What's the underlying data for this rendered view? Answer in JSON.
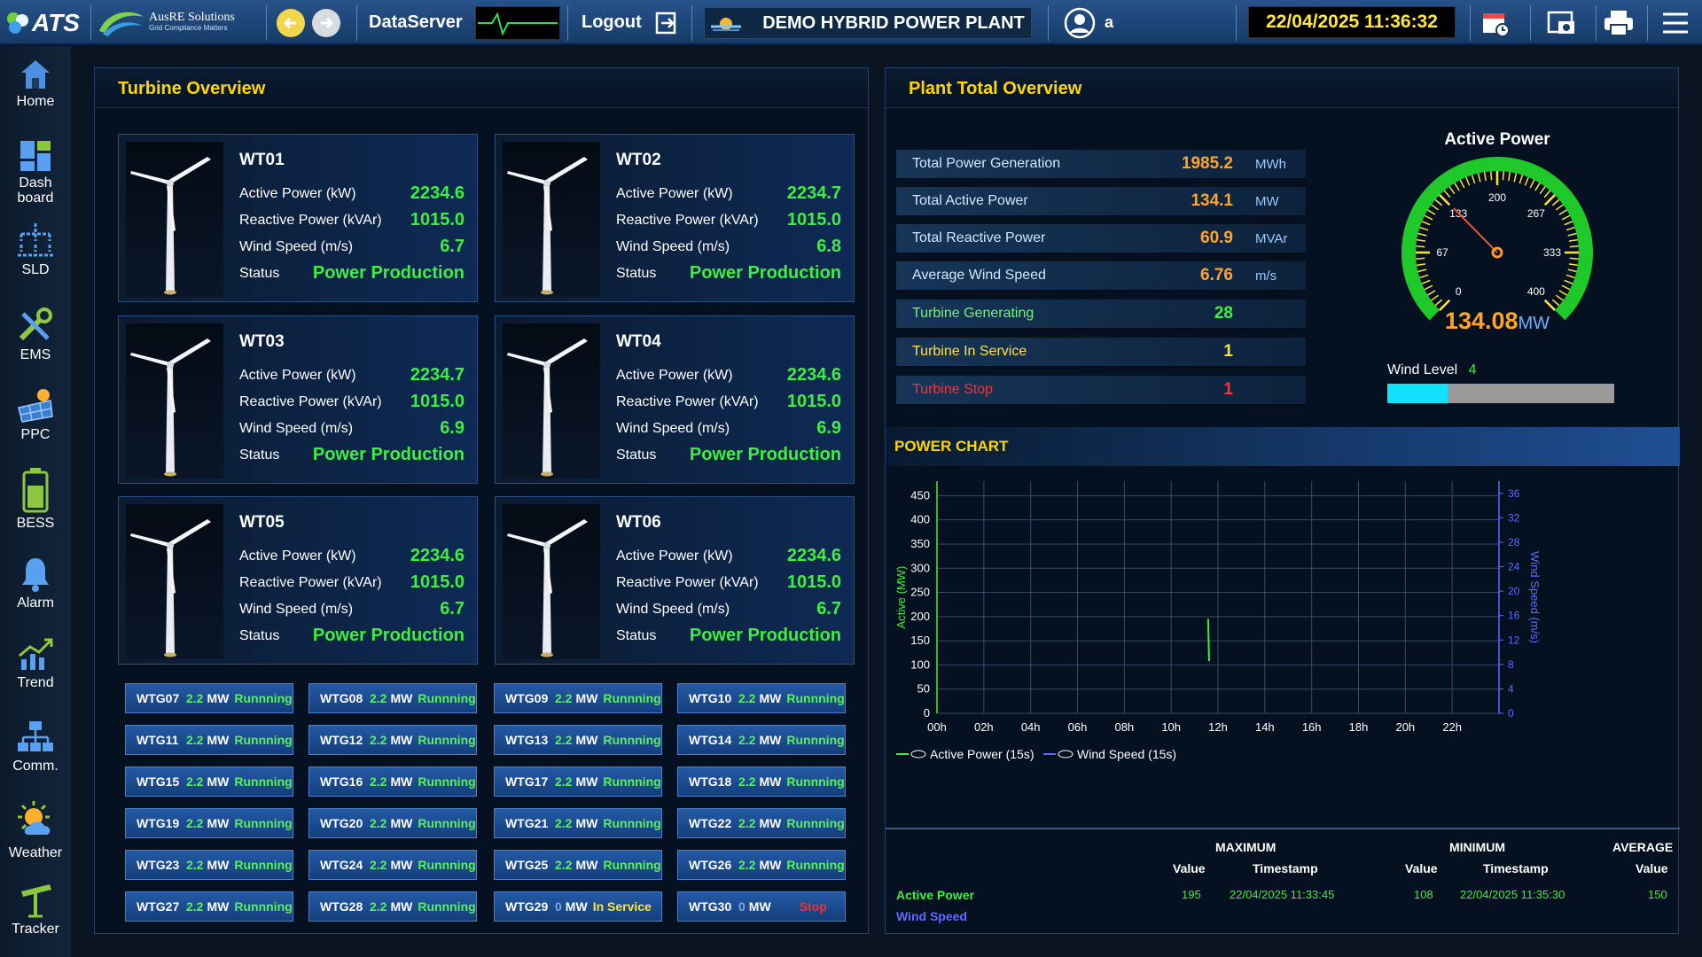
{
  "header": {
    "brand": "ATS",
    "company": "AusRE Solutions",
    "tagline": "Grid Compliance Matters",
    "server": "DataServer",
    "logout": "Logout",
    "plant": "DEMO HYBRID POWER PLANT",
    "user": "a",
    "datetime": "22/04/2025 11:36:32"
  },
  "nav": [
    {
      "label": "Home",
      "icon": "home-icon"
    },
    {
      "label": "Dash board",
      "icon": "dashboard-icon"
    },
    {
      "label": "SLD",
      "icon": "sld-icon"
    },
    {
      "label": "EMS",
      "icon": "tools-icon"
    },
    {
      "label": "PPC",
      "icon": "solar-panel-icon"
    },
    {
      "label": "BESS",
      "icon": "battery-icon"
    },
    {
      "label": "Alarm",
      "icon": "bell-icon"
    },
    {
      "label": "Trend",
      "icon": "trend-icon"
    },
    {
      "label": "Comm.",
      "icon": "network-icon"
    },
    {
      "label": "Weather",
      "icon": "weather-icon"
    },
    {
      "label": "Tracker",
      "icon": "tracker-icon"
    }
  ],
  "turbine_overview": {
    "title": "Turbine Overview",
    "labels": {
      "active": "Active Power (kW)",
      "reactive": "Reactive Power (kVAr)",
      "wind": "Wind Speed (m/s)",
      "status": "Status"
    },
    "turbines": [
      {
        "name": "WT01",
        "active": "2234.6",
        "reactive": "1015.0",
        "wind": "6.7",
        "status": "Power Production"
      },
      {
        "name": "WT02",
        "active": "2234.7",
        "reactive": "1015.0",
        "wind": "6.8",
        "status": "Power Production"
      },
      {
        "name": "WT03",
        "active": "2234.7",
        "reactive": "1015.0",
        "wind": "6.9",
        "status": "Power Production"
      },
      {
        "name": "WT04",
        "active": "2234.6",
        "reactive": "1015.0",
        "wind": "6.9",
        "status": "Power Production"
      },
      {
        "name": "WT05",
        "active": "2234.6",
        "reactive": "1015.0",
        "wind": "6.7",
        "status": "Power Production"
      },
      {
        "name": "WT06",
        "active": "2234.6",
        "reactive": "1015.0",
        "wind": "6.7",
        "status": "Power Production"
      }
    ],
    "wtg": [
      {
        "name": "WTG07",
        "power": "2.2",
        "unit": "MW",
        "status": "Runnning"
      },
      {
        "name": "WTG08",
        "power": "2.2",
        "unit": "MW",
        "status": "Runnning"
      },
      {
        "name": "WTG09",
        "power": "2.2",
        "unit": "MW",
        "status": "Runnning"
      },
      {
        "name": "WTG10",
        "power": "2.2",
        "unit": "MW",
        "status": "Runnning"
      },
      {
        "name": "WTG11",
        "power": "2.2",
        "unit": "MW",
        "status": "Runnning"
      },
      {
        "name": "WTG12",
        "power": "2.2",
        "unit": "MW",
        "status": "Runnning"
      },
      {
        "name": "WTG13",
        "power": "2.2",
        "unit": "MW",
        "status": "Runnning"
      },
      {
        "name": "WTG14",
        "power": "2.2",
        "unit": "MW",
        "status": "Runnning"
      },
      {
        "name": "WTG15",
        "power": "2.2",
        "unit": "MW",
        "status": "Runnning"
      },
      {
        "name": "WTG16",
        "power": "2.2",
        "unit": "MW",
        "status": "Runnning"
      },
      {
        "name": "WTG17",
        "power": "2.2",
        "unit": "MW",
        "status": "Runnning"
      },
      {
        "name": "WTG18",
        "power": "2.2",
        "unit": "MW",
        "status": "Runnning"
      },
      {
        "name": "WTG19",
        "power": "2.2",
        "unit": "MW",
        "status": "Runnning"
      },
      {
        "name": "WTG20",
        "power": "2.2",
        "unit": "MW",
        "status": "Runnning"
      },
      {
        "name": "WTG21",
        "power": "2.2",
        "unit": "MW",
        "status": "Runnning"
      },
      {
        "name": "WTG22",
        "power": "2.2",
        "unit": "MW",
        "status": "Runnning"
      },
      {
        "name": "WTG23",
        "power": "2.2",
        "unit": "MW",
        "status": "Runnning"
      },
      {
        "name": "WTG24",
        "power": "2.2",
        "unit": "MW",
        "status": "Runnning"
      },
      {
        "name": "WTG25",
        "power": "2.2",
        "unit": "MW",
        "status": "Runnning"
      },
      {
        "name": "WTG26",
        "power": "2.2",
        "unit": "MW",
        "status": "Runnning"
      },
      {
        "name": "WTG27",
        "power": "2.2",
        "unit": "MW",
        "status": "Runnning"
      },
      {
        "name": "WTG28",
        "power": "2.2",
        "unit": "MW",
        "status": "Runnning"
      },
      {
        "name": "WTG29",
        "power": "0",
        "unit": "MW",
        "status": "In Service"
      },
      {
        "name": "WTG30",
        "power": "0",
        "unit": "MW",
        "status": "Stop"
      }
    ]
  },
  "plant_total": {
    "title": "Plant Total Overview",
    "rows": [
      {
        "label": "Total Power Generation",
        "value": "1985.2",
        "unit": "MWh"
      },
      {
        "label": "Total Active Power",
        "value": "134.1",
        "unit": "MW"
      },
      {
        "label": "Total Reactive Power",
        "value": "60.9",
        "unit": "MVAr"
      },
      {
        "label": "Average Wind Speed",
        "value": "6.76",
        "unit": "m/s"
      },
      {
        "label": "Turbine Generating",
        "value": "28",
        "unit": ""
      },
      {
        "label": "Turbine In Service",
        "value": "1",
        "unit": ""
      },
      {
        "label": "Turbine Stop",
        "value": "1",
        "unit": ""
      }
    ],
    "gauge": {
      "title": "Active Power",
      "value": "134.08",
      "unit": "MW",
      "min": 0,
      "max": 400,
      "ticks": [
        "0",
        "67",
        "133",
        "200",
        "267",
        "333",
        "400"
      ]
    },
    "wind_level": {
      "label": "Wind Level",
      "value": "4",
      "max": 15
    }
  },
  "colors": {
    "green": "#3ef03e",
    "yellow": "#ffd700",
    "red": "#ff2a2a",
    "blue_line": "#5b6dff",
    "orange": "#ffa426"
  },
  "chart": {
    "title": "POWER CHART",
    "ylabel": "Active (MW)",
    "y2label": "Wind Speed (m/s)",
    "legend_active": "Active Power (15s)",
    "legend_wind": "Wind Speed (15s)"
  },
  "chart_data": {
    "type": "line",
    "x_ticks": [
      "00h",
      "02h",
      "04h",
      "06h",
      "08h",
      "10h",
      "12h",
      "14h",
      "16h",
      "18h",
      "20h",
      "22h"
    ],
    "xlim": [
      0,
      24
    ],
    "ylim": [
      0,
      480
    ],
    "y_ticks": [
      0,
      50,
      100,
      150,
      200,
      250,
      300,
      350,
      400,
      450
    ],
    "y2lim": [
      0,
      38
    ],
    "y2_ticks": [
      0,
      4,
      8,
      12,
      16,
      20,
      24,
      28,
      32,
      36
    ],
    "grid": true,
    "legend": "bottom-left",
    "series": [
      {
        "name": "Active Power (15s)",
        "axis": "left",
        "color": "#3ef03e",
        "x": [
          11.58,
          11.59,
          11.6,
          11.61,
          11.62
        ],
        "y": [
          195,
          170,
          150,
          125,
          108
        ]
      },
      {
        "name": "Wind Speed (15s)",
        "axis": "right",
        "color": "#5b6dff",
        "x": [],
        "y": []
      }
    ]
  },
  "stats": {
    "max_label": "MAXIMUM",
    "min_label": "MINIMUM",
    "avg_label": "AVERAGE",
    "value_label": "Value",
    "timestamp_label": "Timestamp",
    "rows": [
      {
        "name": "Active Power",
        "max_value": "195",
        "max_ts": "22/04/2025 11:33:45",
        "min_value": "108",
        "min_ts": "22/04/2025 11:35:30",
        "avg": "150"
      },
      {
        "name": "Wind Speed",
        "max_value": "",
        "max_ts": "",
        "min_value": "",
        "min_ts": "",
        "avg": ""
      }
    ]
  }
}
